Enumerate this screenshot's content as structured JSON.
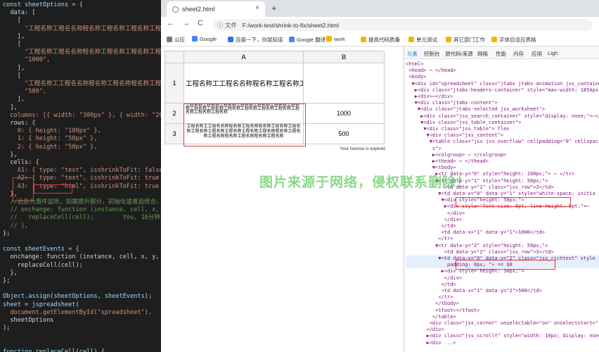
{
  "editor": {
    "lines": [
      "const sheetOptions = {",
      "  data: [",
      "    [",
      "      \"工程名称工程名名称程名称工程名称工程名称工程名",
      "    ],",
      "    [",
      "      \"工程名称工程名名称程名称工程名称工程名称工程名",
      "      \"1000\",",
      "    ],",
      "    [",
      "      \"工程名称工工程名名称程名称工程名称程名称工程名称",
      "      \"500\",",
      "    ],",
      "  ],",
      "  columns: [{ width: \"300px\" }, { width: \"200px\" }]",
      "  rows: {",
      "    0: { height: \"100px\" },",
      "    1: { height: \"50px\" },",
      "    2: { height: \"50px\" },",
      "  },",
      "  cells: {",
      "    A1: { type: \"text\", isshrinkToFit: false },",
      "    A2: { type: \"text\", isshrinkToFit: true },",
      "    A3: { type: \"html\", isshrinkToFit: true },",
      "  },",
      "  //此处为事件监听，如需提升部分，初始化或者后修合，如",
      "  // onchange: function (instance, cell, x, y, valu",
      "  //   replaceCell(cell);        You, 16分钟前 • Uncom",
      "  // },",
      "};",
      "",
      "const sheetEvents = {",
      "  onchange: function (instance, cell, x, y, value)",
      "    replaceCell(cell);",
      "  },",
      "};",
      "",
      "Object.assign(sheetOptions, sheetEvents);",
      "sheet = jspreadsheet(",
      "  document.getElementById(\"spreadsheet\"),",
      "  sheetOptions",
      ");",
      "",
      "",
      "function replaceCell(cell) {"
    ]
  },
  "browser": {
    "tab_title": "sheet2.html",
    "tab_close": "×",
    "new_tab": "+",
    "nav": {
      "back": "←",
      "forward": "→",
      "reload": "C"
    },
    "url_info": "ⓘ 文件",
    "url": "F:/work-test/shrink-to-fix/sheet2.html",
    "bookmarks": [
      {
        "label": "公应",
        "color": "#777"
      },
      {
        "label": "Google",
        "color": "#4285f4"
      },
      {
        "label": "百度一下，你就知道",
        "color": "#2f6fe4"
      },
      {
        "label": "Google 翻译",
        "color": "#4285f4"
      },
      {
        "label": "work",
        "color": "#f4b400"
      },
      {
        "label": "提高代码质量",
        "color": "#f4b400"
      },
      {
        "label": "单元测试",
        "color": "#f4b400"
      },
      {
        "label": "其它部门工作",
        "color": "#f4b400"
      },
      {
        "label": "字体自适应表格",
        "color": "#f4b400"
      }
    ]
  },
  "spreadsheet": {
    "col_headers": [
      "A",
      "B"
    ],
    "row_headers": [
      "1",
      "2",
      "3"
    ],
    "cells": {
      "A1": "工程名称工工程名名称程名称工程名称工程",
      "A2": "工程名称工程名称工程名称工程名称工程名称工程名称工程名称工程名称工程名称工程名称工程名称工程名称工程名称工程名称工程名称工程名称",
      "A3": "工程名称工工程名名称程名称工程名称程名称工程名称工程名称工程名称工程名称工程名称工程名称工程名称程名称工程名称工程名称程名称工程名称程名称工程名称",
      "B1": "",
      "B2": "1000",
      "B3": "500"
    },
    "license": "Your license is expired"
  },
  "devtools": {
    "tabs": [
      "元素",
      "控制台",
      "源代码/来源",
      "网络",
      "性能",
      "内存",
      "应用",
      "Ligh"
    ],
    "dom_lines": [
      "<html>",
      " <head> ⋯ </head>",
      " <body>",
      "  ▼<div id=\"spreadsheet\" class=\"jtabs jtabs-animation jss_container\">",
      "   ▶<div class=\"jtabs-headers-container\" style=\"max-width: 1854px; dis",
      "   ▶<div>⋯</div>",
      "   ▼<div class=\"jtabs-content\">",
      "    ▼<div class=\"jtabs-selected jss_worksheet\">",
      "     ▶<div class=\"jss_search_container\" style=\"display: none;\">⋯</d",
      "     ▼<div class=\"jss_table_container\">",
      "      ▼<div class=\"jss_table\"> flex",
      "       ▼<div class=\"jss_content\">",
      "        ▼<table class=\"jss jss_overflow\" cellpadding=\"0\" cellspaci",
      "         s\">",
      "         ▶<colgroup> ⋯ </colgroup>",
      "         ▶<thead> ⋯ </thead>",
      "         ▼<tbody>",
      "          ▶<tr data-y=\"0\" style=\"height: 100px;\"> ⋯ </tr>",
      "          ▼<tr data-y=\"1\" style=\"height: 50px;\">",
      "             <td data-y=\"1\" class=\"jss_row\">2</td>",
      "           ▼<td data-x=\"0\" data-y=\"1\" style=\"white-space: initia",
      "            ▼<div style=\"height: 50px;\">",
      "             ▶<div style=\"font-size: 9pt; line-height: 9pt;\">⋯",
      "              </div>",
      "             </div>",
      "            </td>",
      "            <td data-x=\"1\" data-y=\"1\">1000</td>",
      "           </tr>",
      "          ▼<tr data-y=\"2\" style=\"height: 50px;\">",
      "             <td data-y=\"2\" class=\"jss_row\">3</td>",
      "           ▼<td data-x=\"0\" data-y=\"2\" class=\"jss_richtext\" style",
      "              padding: 0px; \"> == $0",
      "            ▶<div style=\"height: 50px;\">",
      "             </div>",
      "            </td>",
      "            <td data-x=\"1\" data-y=\"2\">500</td>",
      "           </tr>",
      "          </tbody>",
      "          <tfoot></tfoot>",
      "         </table>",
      "        <div class=\"jss_corner\" unselectable=\"on\" onselectstart=\"",
      "       </div>",
      "       ▶<div class=\"jss_scrollY\" style=\"width: 10px; display: none;",
      "       ▶<div ...>"
    ]
  },
  "watermark": "图片来源于网络，侵权联系删除！"
}
